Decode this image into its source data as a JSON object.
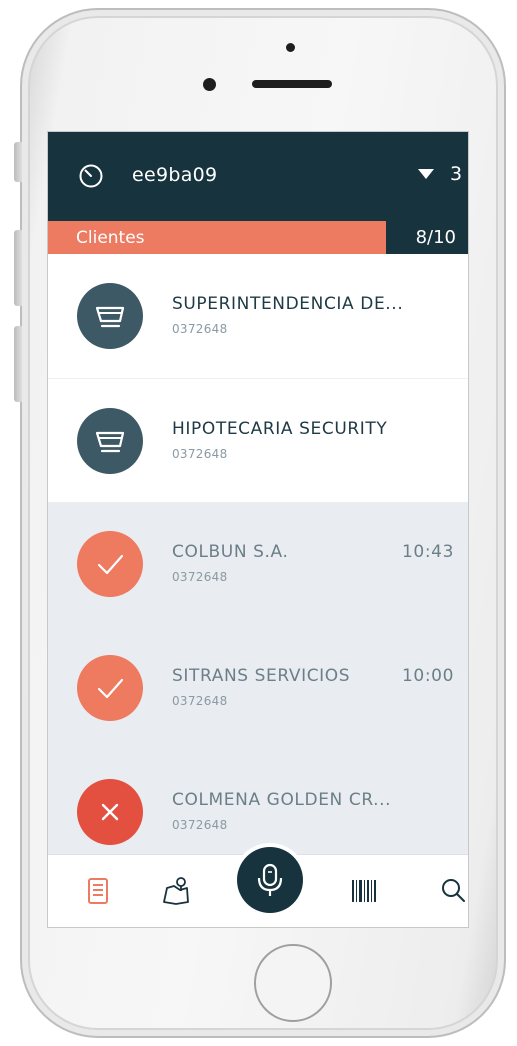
{
  "header": {
    "device_id": "ee9ba09",
    "count": "3",
    "clock_icon": "clock-icon",
    "caret_icon": "caret-down-icon"
  },
  "progress": {
    "label": "Clientes",
    "count_text": "8/10",
    "fraction": 0.8
  },
  "clients": [
    {
      "name": "SUPERINTENDENCIA DE...",
      "code": "0372648",
      "time": "",
      "status": "pending",
      "icon": "cart-icon"
    },
    {
      "name": "HIPOTECARIA SECURITY",
      "code": "0372648",
      "time": "",
      "status": "pending",
      "icon": "cart-icon"
    },
    {
      "name": "COLBUN S.A.",
      "code": "0372648",
      "time": "10:43",
      "status": "done",
      "icon": "check-icon"
    },
    {
      "name": "SITRANS SERVICIOS",
      "code": "0372648",
      "time": "10:00",
      "status": "done",
      "icon": "check-icon"
    },
    {
      "name": "COLMENA GOLDEN CR...",
      "code": "0372648",
      "time": "",
      "status": "failed",
      "icon": "x-icon"
    }
  ],
  "nav": {
    "items": [
      "list-icon",
      "map-pin-icon",
      "mic-icon",
      "barcode-icon",
      "search-icon"
    ]
  },
  "colors": {
    "dark": "#17333d",
    "accent": "#ec7b61",
    "pending_avatar": "#3d5966",
    "done_avatar": "#ee7a5f",
    "failed_avatar": "#e4503f",
    "list_bg": "#e9edf1"
  }
}
